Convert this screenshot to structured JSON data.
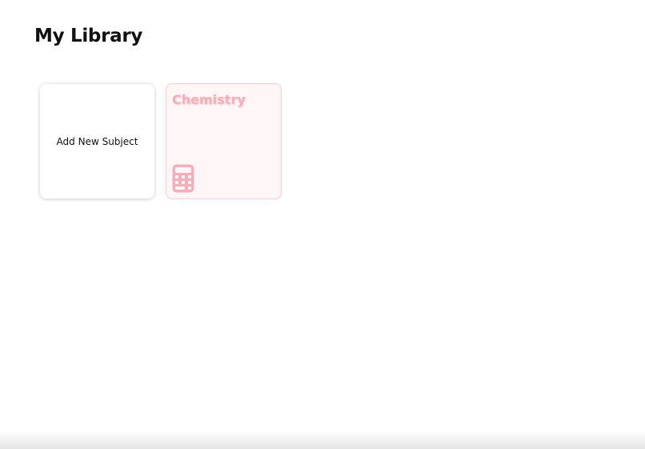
{
  "header": {
    "title": "My Library"
  },
  "library": {
    "add_card_label": "Add New Subject",
    "subjects": [
      {
        "title": "Chemistry",
        "icon": "calculator-icon"
      }
    ]
  },
  "colors": {
    "subject_card_accent": "#f3b0ba",
    "subject_card_border": "#f6cbd2",
    "subject_card_background": "#fff6f7"
  }
}
